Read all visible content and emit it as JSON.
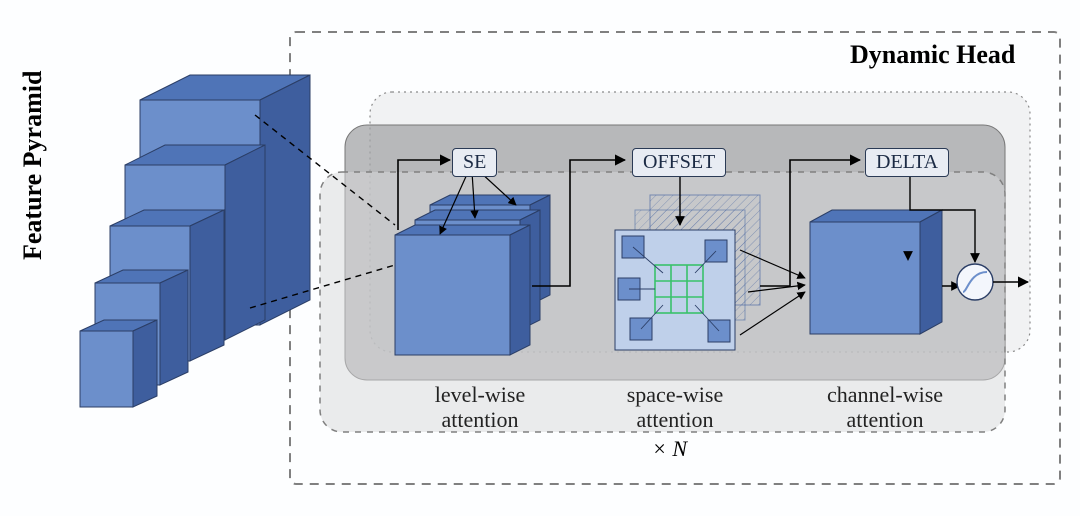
{
  "labels": {
    "feature_pyramid": "Feature Pyramid",
    "dynamic_head": "Dynamic Head",
    "repeat": "× N"
  },
  "modules": {
    "se": {
      "name": "SE",
      "caption": "level-wise\nattention"
    },
    "offset": {
      "name": "OFFSET",
      "caption": "space-wise\nattention"
    },
    "delta": {
      "name": "DELTA",
      "caption": "channel-wise\nattention"
    }
  },
  "colors": {
    "cube_face": "#6C8FCB",
    "cube_top": "#4F74B7",
    "cube_side": "#3E5E9E",
    "cube_edge": "#2B3E66",
    "panel_dark": "#9EA0A3",
    "panel_light": "#C9CACC",
    "panel_faint": "#E2E3E5",
    "border_dashed": "#808080",
    "green": "#39C26B"
  }
}
